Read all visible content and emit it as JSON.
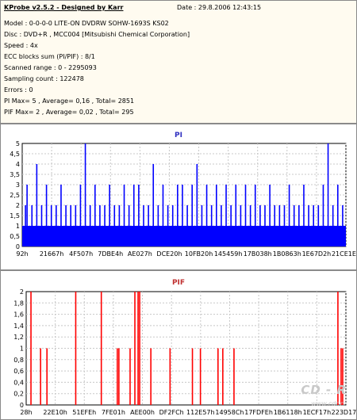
{
  "info": {
    "title": "KProbe v2.5.2 - Designed by Karr",
    "date": "Date : 29.8.2006 12:43:15",
    "lines": [
      "Model : 0-0-0-0 LITE-ON DVDRW SOHW-1693S KS02",
      "Disc : DVD+R , MCC004 [Mitsubishi Chemical Corporation]",
      "Speed : 4x",
      "ECC blocks sum (PI/PIF) : 8/1",
      "Scanned range : 0 - 2295093",
      "Sampling count : 122478",
      "Errors : 0",
      "PI Max= 5 , Average= 0,16 , Total= 2851",
      "PIF Max= 2 , Average= 0,02 , Total= 295"
    ]
  },
  "watermark": {
    "logo": "CD - R",
    "url": "www.cdr.cz"
  },
  "chart_data": [
    {
      "type": "bar",
      "title": "PI",
      "color": "#0000ff",
      "ylim": [
        0,
        5
      ],
      "y_ticks": [
        "0",
        "0,5",
        "1",
        "1,5",
        "2",
        "2,5",
        "3",
        "3,5",
        "4",
        "4,5",
        "5"
      ],
      "x_tick_labels": [
        "92h",
        "21667h",
        "4F507h",
        "7DBE4h",
        "AE027h",
        "DCE20h",
        "10FB20h",
        "145459h",
        "17B038h",
        "1B0863h",
        "1E67D2h",
        "21CE1Eh"
      ],
      "grid": true,
      "baseline_level": 1,
      "spikes": [
        {
          "x": 0.01,
          "v": 2
        },
        {
          "x": 0.015,
          "v": 3
        },
        {
          "x": 0.03,
          "v": 2
        },
        {
          "x": 0.045,
          "v": 4
        },
        {
          "x": 0.06,
          "v": 2
        },
        {
          "x": 0.075,
          "v": 3
        },
        {
          "x": 0.09,
          "v": 2
        },
        {
          "x": 0.105,
          "v": 2
        },
        {
          "x": 0.12,
          "v": 3
        },
        {
          "x": 0.135,
          "v": 2
        },
        {
          "x": 0.15,
          "v": 2
        },
        {
          "x": 0.165,
          "v": 2
        },
        {
          "x": 0.18,
          "v": 3
        },
        {
          "x": 0.195,
          "v": 5
        },
        {
          "x": 0.21,
          "v": 2
        },
        {
          "x": 0.225,
          "v": 3
        },
        {
          "x": 0.24,
          "v": 2
        },
        {
          "x": 0.255,
          "v": 2
        },
        {
          "x": 0.27,
          "v": 3
        },
        {
          "x": 0.285,
          "v": 2
        },
        {
          "x": 0.3,
          "v": 2
        },
        {
          "x": 0.315,
          "v": 3
        },
        {
          "x": 0.33,
          "v": 2
        },
        {
          "x": 0.345,
          "v": 3
        },
        {
          "x": 0.36,
          "v": 3
        },
        {
          "x": 0.375,
          "v": 2
        },
        {
          "x": 0.39,
          "v": 2
        },
        {
          "x": 0.405,
          "v": 4
        },
        {
          "x": 0.42,
          "v": 2
        },
        {
          "x": 0.435,
          "v": 3
        },
        {
          "x": 0.45,
          "v": 2
        },
        {
          "x": 0.465,
          "v": 2
        },
        {
          "x": 0.48,
          "v": 3
        },
        {
          "x": 0.495,
          "v": 3
        },
        {
          "x": 0.51,
          "v": 2
        },
        {
          "x": 0.525,
          "v": 3
        },
        {
          "x": 0.54,
          "v": 4
        },
        {
          "x": 0.555,
          "v": 2
        },
        {
          "x": 0.57,
          "v": 3
        },
        {
          "x": 0.585,
          "v": 2
        },
        {
          "x": 0.6,
          "v": 3
        },
        {
          "x": 0.615,
          "v": 2
        },
        {
          "x": 0.63,
          "v": 3
        },
        {
          "x": 0.645,
          "v": 2
        },
        {
          "x": 0.66,
          "v": 3
        },
        {
          "x": 0.675,
          "v": 2
        },
        {
          "x": 0.69,
          "v": 3
        },
        {
          "x": 0.705,
          "v": 2
        },
        {
          "x": 0.72,
          "v": 3
        },
        {
          "x": 0.735,
          "v": 2
        },
        {
          "x": 0.75,
          "v": 2
        },
        {
          "x": 0.765,
          "v": 3
        },
        {
          "x": 0.78,
          "v": 2
        },
        {
          "x": 0.795,
          "v": 2
        },
        {
          "x": 0.81,
          "v": 2
        },
        {
          "x": 0.825,
          "v": 3
        },
        {
          "x": 0.84,
          "v": 2
        },
        {
          "x": 0.855,
          "v": 2
        },
        {
          "x": 0.87,
          "v": 3
        },
        {
          "x": 0.885,
          "v": 2
        },
        {
          "x": 0.9,
          "v": 2
        },
        {
          "x": 0.915,
          "v": 2
        },
        {
          "x": 0.93,
          "v": 3
        },
        {
          "x": 0.945,
          "v": 5
        },
        {
          "x": 0.96,
          "v": 2
        },
        {
          "x": 0.975,
          "v": 3
        },
        {
          "x": 0.99,
          "v": 2
        }
      ]
    },
    {
      "type": "bar",
      "title": "PIF",
      "color": "#ff0000",
      "ylim": [
        0,
        2
      ],
      "y_ticks": [
        "0",
        "0,2",
        "0,4",
        "0,6",
        "0,8",
        "1",
        "1,2",
        "1,4",
        "1,6",
        "1,8",
        "2"
      ],
      "x_tick_labels": [
        "28h",
        "22E10h",
        "51EFEh",
        "7FE01h",
        "AEE00h",
        "DF2FCh",
        "112E57h",
        "14958Ch",
        "17FDFEh",
        "1B6118h",
        "1ECF17h",
        "223D17h"
      ],
      "grid": true,
      "spikes": [
        {
          "x": 0.015,
          "v": 2
        },
        {
          "x": 0.045,
          "v": 1
        },
        {
          "x": 0.065,
          "v": 1
        },
        {
          "x": 0.155,
          "v": 2
        },
        {
          "x": 0.235,
          "v": 2
        },
        {
          "x": 0.285,
          "v": 1
        },
        {
          "x": 0.29,
          "v": 1
        },
        {
          "x": 0.325,
          "v": 1
        },
        {
          "x": 0.34,
          "v": 2
        },
        {
          "x": 0.35,
          "v": 2
        },
        {
          "x": 0.355,
          "v": 2
        },
        {
          "x": 0.39,
          "v": 1
        },
        {
          "x": 0.45,
          "v": 1
        },
        {
          "x": 0.52,
          "v": 1
        },
        {
          "x": 0.545,
          "v": 1
        },
        {
          "x": 0.6,
          "v": 1
        },
        {
          "x": 0.615,
          "v": 1
        },
        {
          "x": 0.65,
          "v": 1
        },
        {
          "x": 0.975,
          "v": 2
        },
        {
          "x": 0.985,
          "v": 1
        },
        {
          "x": 0.99,
          "v": 1
        }
      ]
    }
  ]
}
